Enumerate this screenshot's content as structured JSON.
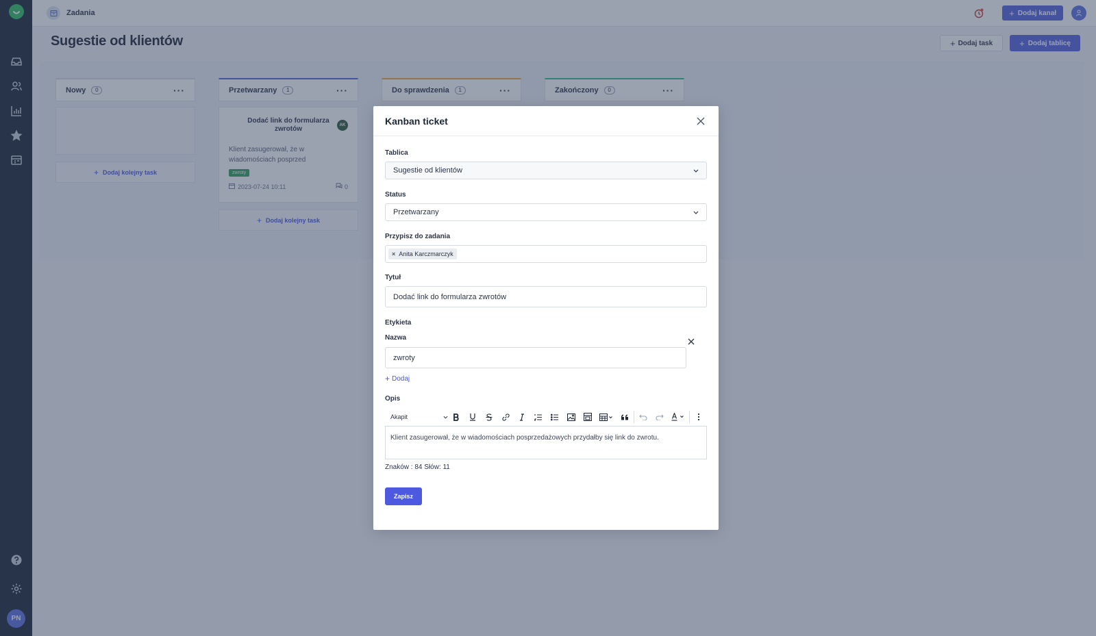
{
  "topbar": {
    "breadcrumb": "Zadania",
    "add_channel_label": "Dodaj kanał"
  },
  "page": {
    "title": "Sugestie od klientów",
    "add_task_label": "Dodaj task",
    "add_board_label": "Dodaj tablicę"
  },
  "sidebar": {
    "avatar_initials": "PN",
    "items": [
      {
        "name": "inbox-icon"
      },
      {
        "name": "contacts-icon"
      },
      {
        "name": "reports-icon"
      },
      {
        "name": "star-icon"
      },
      {
        "name": "kanban-icon"
      }
    ]
  },
  "columns": [
    {
      "name": "Nowy",
      "count": "0",
      "color": "#d9dde5"
    },
    {
      "name": "Przetwarzany",
      "count": "1",
      "color": "#5563de"
    },
    {
      "name": "Do sprawdzenia",
      "count": "1",
      "color": "#f0a53c"
    },
    {
      "name": "Zakończony",
      "count": "0",
      "color": "#2fbf8a"
    }
  ],
  "add_next_task_label": "Dodaj kolejny task",
  "card": {
    "title": "Dodać link do formularza zwrotów",
    "assignee_initials": "AK",
    "description": "Klient zasugerował, że w wiadomościach posprzed",
    "tag": "zwroty",
    "date": "2023-07-24 10:11",
    "comments": "0"
  },
  "modal": {
    "title": "Kanban ticket",
    "board_label": "Tablica",
    "board_value": "Sugestie od klientów",
    "status_label": "Status",
    "status_value": "Przetwarzany",
    "assign_label": "Przypisz do zadania",
    "assignee_chip": "Anita Karczmarczyk",
    "title_label": "Tytuł",
    "title_value": "Dodać link do formularza zwrotów",
    "label_section": "Etykieta",
    "label_name_label": "Nazwa",
    "label_name_value": "zwroty",
    "add_label": "Dodaj",
    "description_label": "Opis",
    "paragraph_style": "Akapit",
    "description_value": "Klient zasugerował, że w wiadomościach posprzedażowych przydałby się link do zwrotu.",
    "counter": "Znaków : 84 Słów: 11",
    "save_label": "Zapisz"
  },
  "colors": {
    "accent": "#5563de",
    "sidebar_bg": "#1b2434",
    "tag_green": "#31a35d"
  }
}
